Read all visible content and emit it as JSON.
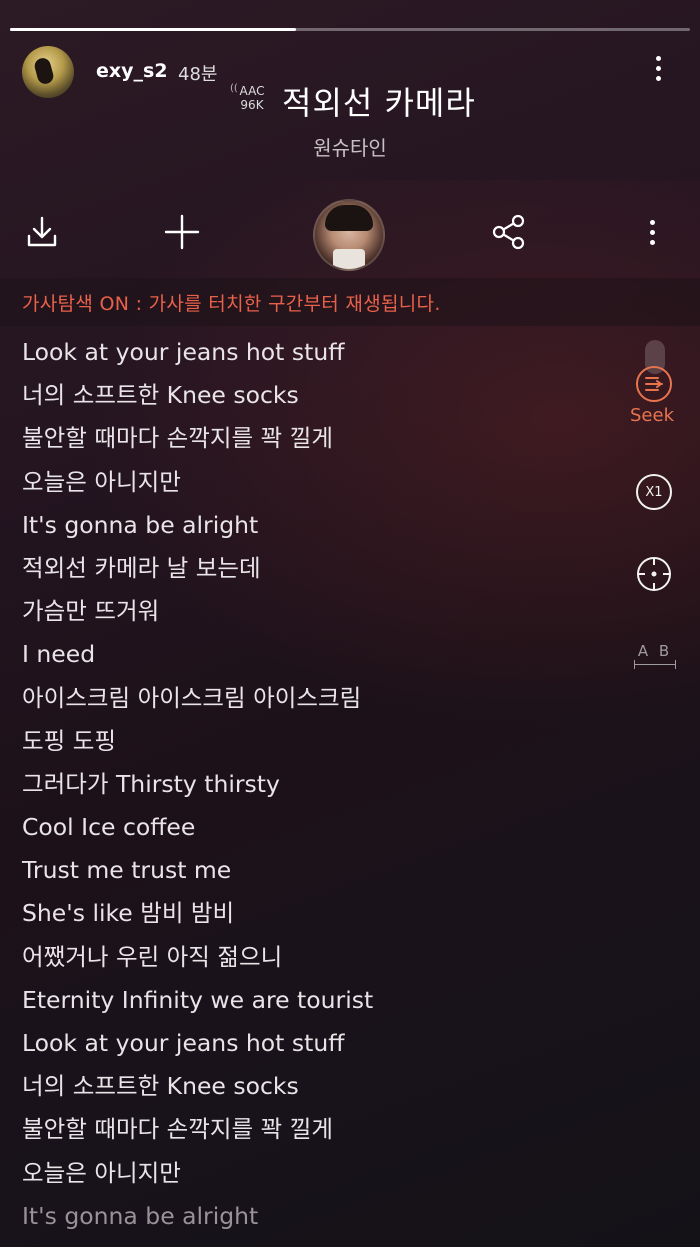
{
  "player": {
    "progress_fraction": 0.42
  },
  "header": {
    "username": "exy_s2",
    "time_ago": "48분",
    "codec_line1": "AAC",
    "codec_line2": "96K",
    "song_title": "적외선 카메라",
    "artist": "원슈타인"
  },
  "toolbar": {
    "download_icon": "download-icon",
    "add_icon": "plus-icon",
    "share_icon": "share-icon",
    "more_icon": "more-vertical-icon"
  },
  "lyric_search": {
    "notice": "가사탐색 ON : 가사를 터치한 구간부터 재생됩니다."
  },
  "side_controls": {
    "seek_label": "Seek",
    "speed_label": "X1",
    "ab_label": "A B"
  },
  "lyrics": [
    "Look at your jeans hot stuff",
    "너의 소프트한 Knee socks",
    "불안할 때마다 손깍지를 꽉 낄게",
    "오늘은 아니지만",
    "It's gonna be alright",
    "적외선 카메라 날 보는데",
    "가슴만 뜨거워",
    "I need",
    "아이스크림 아이스크림 아이스크림",
    "도핑 도핑",
    "그러다가 Thirsty thirsty",
    "Cool Ice coffee",
    "Trust me trust me",
    "She's like 밤비 밤비",
    "어쨌거나 우린 아직 젊으니",
    "Eternity Infinity we are tourist",
    "Look at your jeans hot stuff",
    "너의 소프트한 Knee socks",
    "불안할 때마다 손깍지를 꽉 낄게",
    "오늘은 아니지만",
    "It's gonna be alright"
  ]
}
